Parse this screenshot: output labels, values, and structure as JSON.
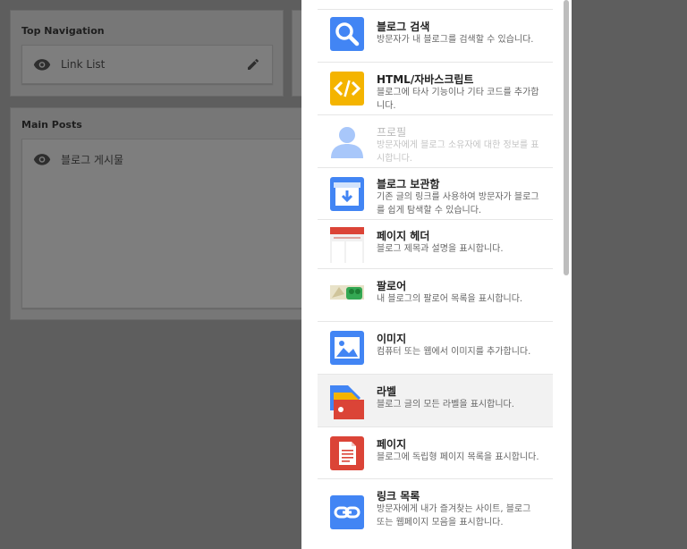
{
  "layout_sections": {
    "top_navigation": {
      "title": "Top Navigation",
      "widget_label": "Link List"
    },
    "main_posts": {
      "title": "Main Posts",
      "widget_label": "블로그 게시물"
    }
  },
  "gadgets": [
    {
      "title": "블로그 검색",
      "desc": "방문자가 내 블로그를 검색할 수 있습니다.",
      "icon": "search-icon",
      "color": "#4285f4"
    },
    {
      "title": "HTML/자바스크립트",
      "desc": "블로그에 타사 기능이나 기타 코드를 추가합니다.",
      "icon": "code-icon",
      "color": "#f4b400"
    },
    {
      "title": "프로필",
      "desc": "방문자에게 블로그 소유자에 대한 정보를 표시합니다.",
      "icon": "profile-icon",
      "color": "#a8c7fa"
    },
    {
      "title": "블로그 보관함",
      "desc": "기존 글의 링크를 사용하여 방문자가 블로그를 쉽게 탐색할 수 있습니다.",
      "icon": "archive-icon",
      "color": "#4285f4"
    },
    {
      "title": "페이지 헤더",
      "desc": "블로그 제목과 설명을 표시합니다.",
      "icon": "page-header-icon",
      "color": "#db4437"
    },
    {
      "title": "팔로어",
      "desc": "내 블로그의 팔로어 목록을 표시합니다.",
      "icon": "followers-icon",
      "color": "#34a853"
    },
    {
      "title": "이미지",
      "desc": "컴퓨터 또는 웹에서 이미지를 추가합니다.",
      "icon": "image-icon",
      "color": "#4285f4"
    },
    {
      "title": "라벨",
      "desc": "블로그 글의 모든 라벨을 표시합니다.",
      "icon": "label-icon",
      "color": "#db4437"
    },
    {
      "title": "페이지",
      "desc": "블로그에 독립형 페이지 목록을 표시합니다.",
      "icon": "pages-icon",
      "color": "#db4437"
    },
    {
      "title": "링크 목록",
      "desc": "방문자에게 내가 즐겨찾는 사이트, 블로그 또는 웹페이지 모음을 표시합니다.",
      "icon": "link-icon",
      "color": "#4285f4"
    }
  ]
}
